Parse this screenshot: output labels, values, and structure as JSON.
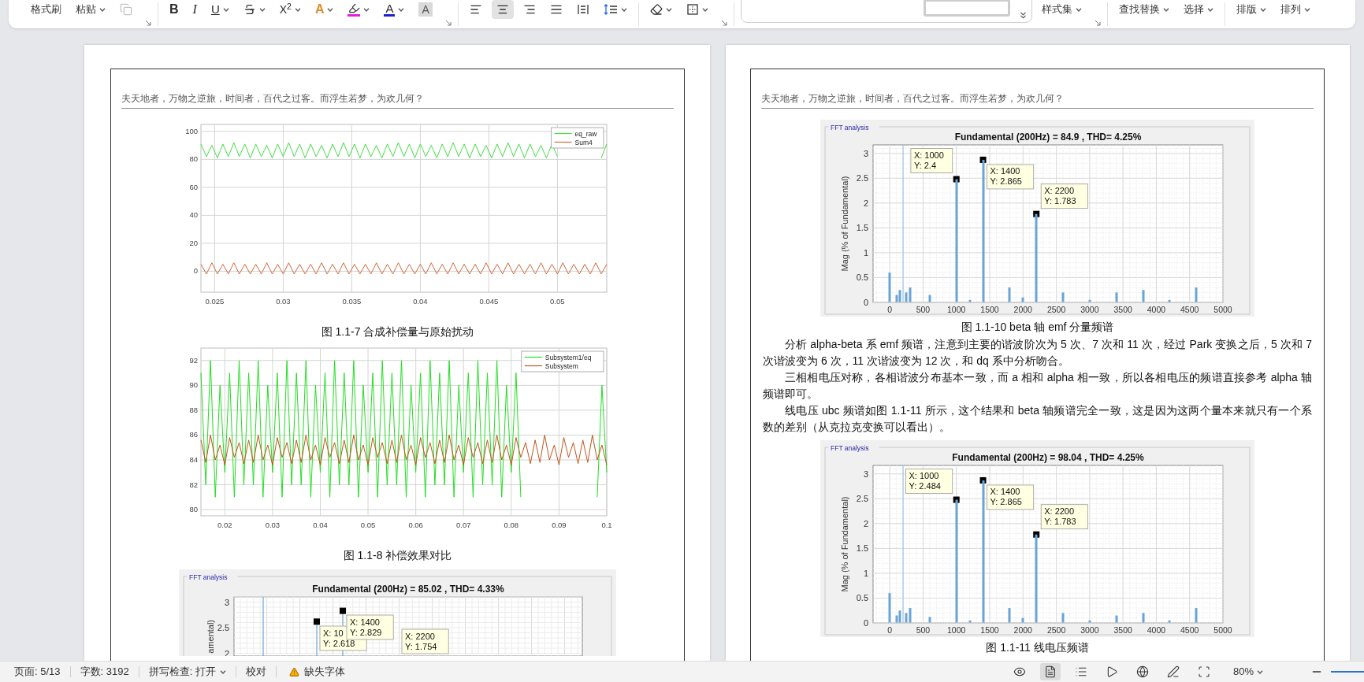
{
  "ribbon": [
    {
      "items": [
        {
          "kind": "text",
          "label": "格式刷"
        },
        {
          "kind": "text",
          "label": "粘贴",
          "dropdown": true
        },
        {
          "kind": "icon",
          "disabled": true
        }
      ],
      "launcher": true
    },
    {
      "items": [
        {
          "kind": "glyph",
          "label": "B"
        },
        {
          "kind": "glyph",
          "label": "I"
        },
        {
          "kind": "glyph",
          "label": "U",
          "dropdown": true
        },
        {
          "kind": "icon",
          "dropdown": true
        },
        {
          "kind": "glyph",
          "label": "X$^{2}$",
          "dropdown": true
        },
        {
          "kind": "glyph",
          "label": "A",
          "dropdown": true
        },
        {
          "kind": "icon",
          "color": "#e020e0",
          "dropdown": true
        },
        {
          "kind": "glyph",
          "label": "A",
          "color": "#1f1fd0",
          "dropdown": true
        },
        {
          "kind": "glyph",
          "label": "A"
        }
      ],
      "launcher": true
    },
    {
      "items": [
        {
          "kind": "icon",
          "selected": false
        },
        {
          "kind": "icon",
          "selected": true
        },
        {
          "kind": "icon",
          "selected": false
        },
        {
          "kind": "icon",
          "selected": false
        },
        {
          "kind": "icon",
          "selected": false
        },
        {
          "kind": "icon",
          "dropdown": true
        }
      ]
    },
    {
      "items": [
        {
          "kind": "icon",
          "dropdown": true
        },
        {
          "kind": "icon",
          "dropdown": true
        }
      ],
      "launcher": true
    },
    {
      "items": [
        {
          "kind": "gallery"
        },
        {
          "kind": "text",
          "label": "样式集",
          "dropdown": true
        }
      ],
      "launcher": true
    },
    {
      "items": [
        {
          "kind": "text",
          "label": "查找替换",
          "dropdown": true
        },
        {
          "kind": "text",
          "label": "选择",
          "dropdown": true
        }
      ]
    },
    {
      "items": [
        {
          "kind": "text",
          "label": "排版",
          "dropdown": true
        },
        {
          "kind": "text",
          "label": "排列",
          "dropdown": true
        }
      ]
    }
  ],
  "pages": [
    {
      "header": "夫天地者，万物之逆旅，时间者，百代之过客。而浮生若梦，为欢几何？",
      "blocks": [
        {
          "kind": "scope-chart",
          "chart_data": {
            "type": "line",
            "xlim": [
              0.024,
              0.0536
            ],
            "ylim": [
              -15,
              105
            ],
            "xticks": [
              0.025,
              0.03,
              0.035,
              0.04,
              0.045,
              0.05
            ],
            "yticks": [
              0,
              20,
              40,
              60,
              80,
              100
            ],
            "grid": true,
            "legend": true,
            "x": [
              0.024,
              0.0244,
              0.0248,
              0.0252,
              0.0256,
              0.026,
              0.0264,
              0.0268,
              0.0272,
              0.0276,
              0.028,
              0.0284,
              0.0288,
              0.0292,
              0.0296,
              0.03,
              0.0304,
              0.0308,
              0.0312,
              0.0316,
              0.032,
              0.0324,
              0.0328,
              0.0332,
              0.0336,
              0.034,
              0.0344,
              0.0348,
              0.0352,
              0.0356,
              0.036,
              0.0364,
              0.0368,
              0.0372,
              0.0376,
              0.038,
              0.0384,
              0.0388,
              0.0392,
              0.0396,
              0.04,
              0.0404,
              0.0408,
              0.0412,
              0.0416,
              0.042,
              0.0424,
              0.0428,
              0.0432,
              0.0436,
              0.044,
              0.0444,
              0.0448,
              0.0452,
              0.0456,
              0.046,
              0.0464,
              0.0468,
              0.0472,
              0.0476,
              0.048,
              0.0484,
              0.0488,
              0.0492,
              0.0496,
              0.05,
              0.0504,
              0.0508,
              0.0512,
              0.0516,
              0.052,
              0.0524,
              0.0528,
              0.0532,
              0.0536
            ],
            "series": [
              {
                "name": "eq_raw",
                "color": "#45dd45",
                "values": [
                  91,
                  82,
                  90,
                  81,
                  91,
                  82,
                  92,
                  82,
                  91,
                  81,
                  91,
                  82,
                  90,
                  81,
                  91,
                  82,
                  92,
                  82,
                  91,
                  81,
                  91,
                  82,
                  90,
                  81,
                  91,
                  82,
                  92,
                  82,
                  91,
                  81,
                  91,
                  82,
                  90,
                  81,
                  91,
                  82,
                  92,
                  82,
                  91,
                  81,
                  91,
                  82,
                  90,
                  81,
                  91,
                  82,
                  92,
                  82,
                  91,
                  81,
                  91,
                  82,
                  90,
                  81,
                  91,
                  82,
                  92,
                  82,
                  91,
                  81,
                  91,
                  82,
                  90,
                  81,
                  91,
                  82,
                  null,
                  null,
                  null,
                  null,
                  null,
                  null,
                  null,
                  81,
                  91
                ]
              },
              {
                "name": "Sum4",
                "color": "#d0683a",
                "values": [
                  5,
                  -2,
                  6,
                  -2,
                  5,
                  -2,
                  6,
                  -2,
                  5,
                  -2,
                  5,
                  -2,
                  6,
                  -2,
                  5,
                  -2,
                  6,
                  -2,
                  5,
                  -2,
                  5,
                  -2,
                  6,
                  -2,
                  5,
                  -2,
                  6,
                  -2,
                  5,
                  -2,
                  5,
                  -2,
                  6,
                  -2,
                  5,
                  -2,
                  6,
                  -2,
                  5,
                  -2,
                  5,
                  -2,
                  6,
                  -2,
                  5,
                  -2,
                  6,
                  -2,
                  5,
                  -2,
                  5,
                  -2,
                  6,
                  -2,
                  5,
                  -2,
                  6,
                  -2,
                  5,
                  -2,
                  5,
                  -2,
                  6,
                  -2,
                  5,
                  -2,
                  6,
                  -2,
                  5,
                  -2,
                  5,
                  -2,
                  6,
                  -2,
                  5
                ]
              }
            ]
          }
        },
        {
          "kind": "caption",
          "text": "图 1.1-7  合成补偿量与原始扰动"
        },
        {
          "kind": "scope-chart",
          "chart_data": {
            "type": "line",
            "xlim": [
              0.015,
              0.1
            ],
            "ylim": [
              79.5,
              93
            ],
            "xticks": [
              0.02,
              0.03,
              0.04,
              0.05,
              0.06,
              0.07,
              0.08,
              0.09,
              0.1
            ],
            "yticks": [
              80,
              82,
              84,
              86,
              88,
              90,
              92
            ],
            "grid": true,
            "legend": true,
            "x": [
              0.015,
              0.016,
              0.017,
              0.018,
              0.019,
              0.02,
              0.021,
              0.022,
              0.023,
              0.024,
              0.025,
              0.026,
              0.027,
              0.028,
              0.029,
              0.03,
              0.031,
              0.032,
              0.033,
              0.034,
              0.035,
              0.036,
              0.037,
              0.038,
              0.039,
              0.04,
              0.041,
              0.042,
              0.043,
              0.044,
              0.045,
              0.046,
              0.047,
              0.048,
              0.049,
              0.05,
              0.051,
              0.052,
              0.053,
              0.054,
              0.055,
              0.056,
              0.057,
              0.058,
              0.059,
              0.06,
              0.061,
              0.062,
              0.063,
              0.064,
              0.065,
              0.066,
              0.067,
              0.068,
              0.069,
              0.07,
              0.071,
              0.072,
              0.073,
              0.074,
              0.075,
              0.076,
              0.077,
              0.078,
              0.079,
              0.08,
              0.081,
              0.082,
              0.083,
              0.084,
              0.085,
              0.086,
              0.087,
              0.088,
              0.089,
              0.09,
              0.091,
              0.092,
              0.093,
              0.094,
              0.095,
              0.096,
              0.097,
              0.098,
              0.099,
              0.1
            ],
            "series": [
              {
                "name": "Subsystem1/eq",
                "color": "#22dd22",
                "values": [
                  91,
                  82,
                  92,
                  81,
                  90,
                  83,
                  91,
                  81,
                  92,
                  82,
                  91,
                  82,
                  92,
                  81,
                  90,
                  83,
                  91,
                  81,
                  92,
                  82,
                  91,
                  82,
                  92,
                  81,
                  90,
                  83,
                  91,
                  81,
                  92,
                  82,
                  91,
                  82,
                  92,
                  81,
                  90,
                  83,
                  91,
                  81,
                  92,
                  82,
                  91,
                  82,
                  92,
                  81,
                  90,
                  83,
                  91,
                  81,
                  92,
                  82,
                  91,
                  82,
                  92,
                  81,
                  90,
                  83,
                  91,
                  81,
                  92,
                  82,
                  91,
                  82,
                  92,
                  81,
                  90,
                  83,
                  91,
                  81,
                  null,
                  null,
                  null,
                  null,
                  null,
                  null,
                  null,
                  null,
                  null,
                  null,
                  null,
                  null,
                  null,
                  null,
                  null,
                  81,
                  90,
                  83
                ]
              },
              {
                "name": "Subsystem",
                "color": "#c0551e",
                "values": [
                  85.6,
                  83.8,
                  86,
                  84,
                  85.2,
                  83.6,
                  85.8,
                  84.2,
                  85.4,
                  83.7,
                  85.6,
                  83.8,
                  86,
                  84,
                  85.2,
                  83.6,
                  85.8,
                  84.2,
                  85.4,
                  83.7,
                  85.6,
                  83.8,
                  86,
                  84,
                  85.2,
                  83.6,
                  85.8,
                  84.2,
                  85.4,
                  83.7,
                  85.6,
                  83.8,
                  86,
                  84,
                  85.2,
                  83.6,
                  85.8,
                  84.2,
                  85.4,
                  83.7,
                  85.6,
                  83.8,
                  86,
                  84,
                  85.2,
                  83.6,
                  85.8,
                  84.2,
                  85.4,
                  83.7,
                  85.6,
                  83.8,
                  86,
                  84,
                  85.2,
                  83.6,
                  85.8,
                  84.2,
                  85.4,
                  83.7,
                  85.6,
                  83.8,
                  86,
                  84,
                  85.2,
                  83.6,
                  85.8,
                  84.2,
                  85.4,
                  83.7,
                  85.6,
                  83.8,
                  86,
                  84,
                  85.2,
                  83.6,
                  85.8,
                  84.2,
                  85.4,
                  83.7,
                  85.6,
                  83.8,
                  86,
                  84,
                  85.2,
                  83.6
                ]
              }
            ]
          }
        },
        {
          "kind": "caption",
          "text": "图 1.1-8  补偿效果对比"
        },
        {
          "kind": "fft-figure",
          "panel_label": "FFT analysis",
          "title": "Fundamental (200Hz) = 85.02 , THD= 4.33%",
          "ylabel": "amental)",
          "y_tick_labels": [
            "3",
            "2.5",
            "2"
          ],
          "data_tips": [
            "X: 10\nY: 2.618",
            "X: 1400\nY: 2.829",
            "X: 2200\nY: 1.754"
          ]
        }
      ]
    },
    {
      "header": "夫天地者，万物之逆旅，时间者，百代之过客。而浮生若梦，为欢几何？",
      "blocks": [
        {
          "kind": "fft-chart",
          "panel_label": "FFT analysis",
          "chart_data": {
            "type": "bar",
            "title": "Fundamental (200Hz) = 84.9 , THD= 4.25%",
            "ylabel": "Mag (% of Fundamental)",
            "xlim": [
              -250,
              5000
            ],
            "ylim": [
              0,
              3.17
            ],
            "xticks": [
              0,
              500,
              1000,
              1500,
              2000,
              2500,
              3000,
              3500,
              4000,
              4500,
              5000
            ],
            "yticks": [
              0,
              0.5,
              1,
              1.5,
              2,
              2.5,
              3
            ],
            "grid": true,
            "x": [
              0,
              100,
              150,
              250,
              300,
              600,
              1000,
              1200,
              1400,
              1800,
              2000,
              2200,
              2600,
              3000,
              3400,
              3800,
              4200,
              4600
            ],
            "values": [
              0.6,
              0.15,
              0.25,
              0.2,
              0.3,
              0.15,
              2.48,
              0.05,
              2.87,
              0.3,
              0.1,
              1.78,
              0.2,
              0.05,
              0.2,
              0.25,
              0.05,
              0.3
            ],
            "ref_lines": [
              {
                "axis": "x",
                "value": 200,
                "color": "#8cb9e0"
              }
            ],
            "annotations": [
              {
                "x": 1000,
                "y": 2.48,
                "text": "X: 1000\nY: 2.4"
              },
              {
                "x": 1400,
                "y": 2.87,
                "text": "X: 1400\nY: 2.865"
              },
              {
                "x": 2200,
                "y": 1.78,
                "text": "X: 2200\nY: 1.783"
              }
            ]
          }
        },
        {
          "kind": "caption",
          "text": "图 1.1-10 beta 轴 emf 分量频谱"
        },
        {
          "kind": "paragraph",
          "text": "分析 alpha-beta 系 emf 频谱，注意到主要的谐波阶次为 5 次、7 次和 11 次，经过 Park 变换之后，5 次和 7 次谐波变为 6 次，11 次谐波变为 12 次，和 dq 系中分析吻合。"
        },
        {
          "kind": "paragraph",
          "text": "三相相电压对称，各相谐波分布基本一致，而 a 相和 alpha 相一致，所以各相电压的频谱直接参考 alpha 轴频谱即可。"
        },
        {
          "kind": "paragraph",
          "text": "线电压 ubc 频谱如图 1.1-11 所示，这个结果和 beta 轴频谱完全一致，这是因为这两个量本来就只有一个系数的差别（从克拉克变换可以看出）。"
        },
        {
          "kind": "fft-chart",
          "panel_label": "FFT analysis",
          "chart_data": {
            "type": "bar",
            "title": "Fundamental (200Hz) = 98.04 , THD= 4.25%",
            "ylabel": "Mag (% of Fundamental)",
            "xlim": [
              -250,
              5000
            ],
            "ylim": [
              0,
              3.17
            ],
            "xticks": [
              0,
              500,
              1000,
              1500,
              2000,
              2500,
              3000,
              3500,
              4000,
              4500,
              5000
            ],
            "yticks": [
              0,
              0.5,
              1,
              1.5,
              2,
              2.5,
              3
            ],
            "grid": true,
            "x": [
              0,
              100,
              150,
              250,
              300,
              600,
              1000,
              1200,
              1400,
              1800,
              2000,
              2200,
              2600,
              3000,
              3400,
              3800,
              4200,
              4600
            ],
            "values": [
              0.6,
              0.15,
              0.25,
              0.2,
              0.3,
              0.12,
              2.48,
              0.05,
              2.87,
              0.3,
              0.1,
              1.78,
              0.2,
              0.05,
              0.15,
              0.2,
              0.05,
              0.3
            ],
            "ref_lines": [
              {
                "axis": "x",
                "value": 200,
                "color": "#8cb9e0"
              }
            ],
            "annotations": [
              {
                "x": 1000,
                "y": 2.48,
                "text": "X: 1000\nY: 2.484"
              },
              {
                "x": 1400,
                "y": 2.87,
                "text": "X: 1400\nY: 2.865"
              },
              {
                "x": 2200,
                "y": 1.78,
                "text": "X: 2200\nY: 1.783"
              }
            ]
          }
        },
        {
          "kind": "caption",
          "text": "图 1.1-11  线电压频谱"
        }
      ]
    }
  ],
  "status_bar": {
    "left": [
      {
        "kind": "text",
        "label": "页面: 5/13"
      },
      {
        "kind": "text",
        "label": "字数: 3192"
      },
      {
        "kind": "text",
        "label": "拼写检查: 打开",
        "dropdown": true
      },
      {
        "kind": "text",
        "label": "校对"
      },
      {
        "kind": "warning",
        "label": "缺失字体"
      }
    ],
    "views": [
      {
        "selected": false
      },
      {
        "selected": true
      },
      {
        "selected": false
      },
      {
        "selected": false
      },
      {
        "selected": false
      },
      {
        "selected": false
      },
      {
        "selected": false
      }
    ],
    "zoom": "80%"
  }
}
